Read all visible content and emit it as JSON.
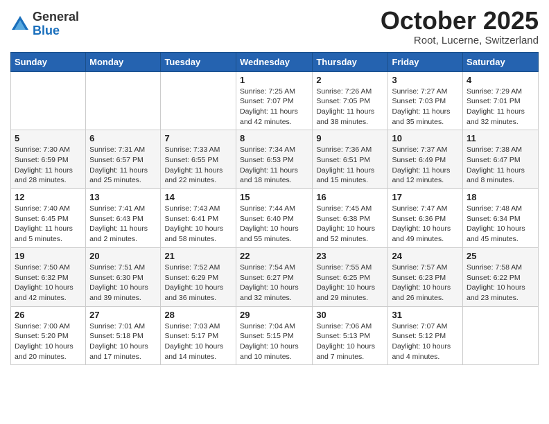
{
  "logo": {
    "general": "General",
    "blue": "Blue"
  },
  "header": {
    "month": "October 2025",
    "location": "Root, Lucerne, Switzerland"
  },
  "weekdays": [
    "Sunday",
    "Monday",
    "Tuesday",
    "Wednesday",
    "Thursday",
    "Friday",
    "Saturday"
  ],
  "weeks": [
    [
      {
        "day": "",
        "info": ""
      },
      {
        "day": "",
        "info": ""
      },
      {
        "day": "",
        "info": ""
      },
      {
        "day": "1",
        "info": "Sunrise: 7:25 AM\nSunset: 7:07 PM\nDaylight: 11 hours and 42 minutes."
      },
      {
        "day": "2",
        "info": "Sunrise: 7:26 AM\nSunset: 7:05 PM\nDaylight: 11 hours and 38 minutes."
      },
      {
        "day": "3",
        "info": "Sunrise: 7:27 AM\nSunset: 7:03 PM\nDaylight: 11 hours and 35 minutes."
      },
      {
        "day": "4",
        "info": "Sunrise: 7:29 AM\nSunset: 7:01 PM\nDaylight: 11 hours and 32 minutes."
      }
    ],
    [
      {
        "day": "5",
        "info": "Sunrise: 7:30 AM\nSunset: 6:59 PM\nDaylight: 11 hours and 28 minutes."
      },
      {
        "day": "6",
        "info": "Sunrise: 7:31 AM\nSunset: 6:57 PM\nDaylight: 11 hours and 25 minutes."
      },
      {
        "day": "7",
        "info": "Sunrise: 7:33 AM\nSunset: 6:55 PM\nDaylight: 11 hours and 22 minutes."
      },
      {
        "day": "8",
        "info": "Sunrise: 7:34 AM\nSunset: 6:53 PM\nDaylight: 11 hours and 18 minutes."
      },
      {
        "day": "9",
        "info": "Sunrise: 7:36 AM\nSunset: 6:51 PM\nDaylight: 11 hours and 15 minutes."
      },
      {
        "day": "10",
        "info": "Sunrise: 7:37 AM\nSunset: 6:49 PM\nDaylight: 11 hours and 12 minutes."
      },
      {
        "day": "11",
        "info": "Sunrise: 7:38 AM\nSunset: 6:47 PM\nDaylight: 11 hours and 8 minutes."
      }
    ],
    [
      {
        "day": "12",
        "info": "Sunrise: 7:40 AM\nSunset: 6:45 PM\nDaylight: 11 hours and 5 minutes."
      },
      {
        "day": "13",
        "info": "Sunrise: 7:41 AM\nSunset: 6:43 PM\nDaylight: 11 hours and 2 minutes."
      },
      {
        "day": "14",
        "info": "Sunrise: 7:43 AM\nSunset: 6:41 PM\nDaylight: 10 hours and 58 minutes."
      },
      {
        "day": "15",
        "info": "Sunrise: 7:44 AM\nSunset: 6:40 PM\nDaylight: 10 hours and 55 minutes."
      },
      {
        "day": "16",
        "info": "Sunrise: 7:45 AM\nSunset: 6:38 PM\nDaylight: 10 hours and 52 minutes."
      },
      {
        "day": "17",
        "info": "Sunrise: 7:47 AM\nSunset: 6:36 PM\nDaylight: 10 hours and 49 minutes."
      },
      {
        "day": "18",
        "info": "Sunrise: 7:48 AM\nSunset: 6:34 PM\nDaylight: 10 hours and 45 minutes."
      }
    ],
    [
      {
        "day": "19",
        "info": "Sunrise: 7:50 AM\nSunset: 6:32 PM\nDaylight: 10 hours and 42 minutes."
      },
      {
        "day": "20",
        "info": "Sunrise: 7:51 AM\nSunset: 6:30 PM\nDaylight: 10 hours and 39 minutes."
      },
      {
        "day": "21",
        "info": "Sunrise: 7:52 AM\nSunset: 6:29 PM\nDaylight: 10 hours and 36 minutes."
      },
      {
        "day": "22",
        "info": "Sunrise: 7:54 AM\nSunset: 6:27 PM\nDaylight: 10 hours and 32 minutes."
      },
      {
        "day": "23",
        "info": "Sunrise: 7:55 AM\nSunset: 6:25 PM\nDaylight: 10 hours and 29 minutes."
      },
      {
        "day": "24",
        "info": "Sunrise: 7:57 AM\nSunset: 6:23 PM\nDaylight: 10 hours and 26 minutes."
      },
      {
        "day": "25",
        "info": "Sunrise: 7:58 AM\nSunset: 6:22 PM\nDaylight: 10 hours and 23 minutes."
      }
    ],
    [
      {
        "day": "26",
        "info": "Sunrise: 7:00 AM\nSunset: 5:20 PM\nDaylight: 10 hours and 20 minutes."
      },
      {
        "day": "27",
        "info": "Sunrise: 7:01 AM\nSunset: 5:18 PM\nDaylight: 10 hours and 17 minutes."
      },
      {
        "day": "28",
        "info": "Sunrise: 7:03 AM\nSunset: 5:17 PM\nDaylight: 10 hours and 14 minutes."
      },
      {
        "day": "29",
        "info": "Sunrise: 7:04 AM\nSunset: 5:15 PM\nDaylight: 10 hours and 10 minutes."
      },
      {
        "day": "30",
        "info": "Sunrise: 7:06 AM\nSunset: 5:13 PM\nDaylight: 10 hours and 7 minutes."
      },
      {
        "day": "31",
        "info": "Sunrise: 7:07 AM\nSunset: 5:12 PM\nDaylight: 10 hours and 4 minutes."
      },
      {
        "day": "",
        "info": ""
      }
    ]
  ]
}
